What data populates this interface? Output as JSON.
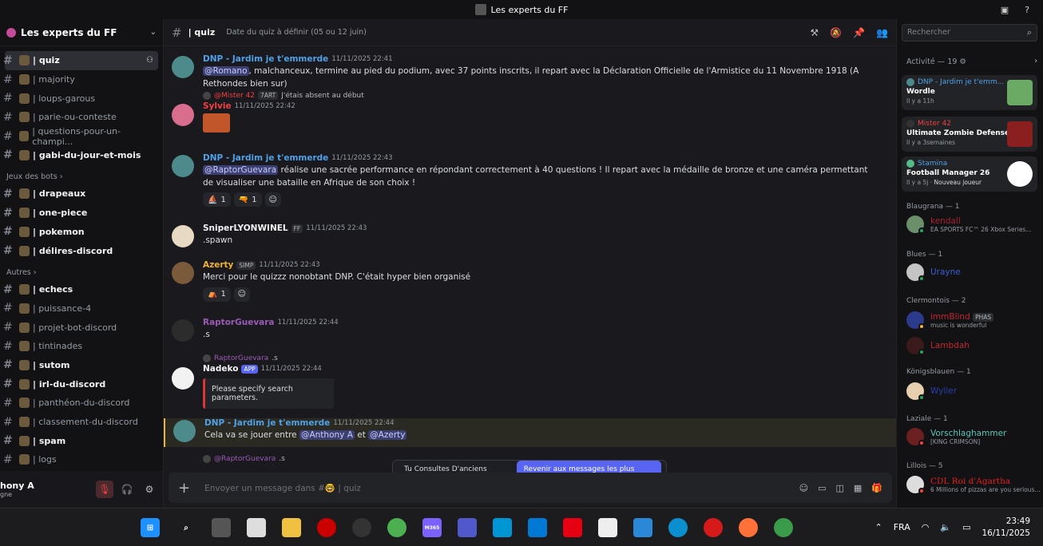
{
  "window": {
    "title": "Les experts du FF"
  },
  "server": {
    "name": "Les experts du FF"
  },
  "channels_top": [
    {
      "name": "| quiz",
      "active": true
    },
    {
      "name": "| majority"
    },
    {
      "name": "| loups-garous"
    },
    {
      "name": "| parie-ou-conteste"
    },
    {
      "name": "| questions-pour-un-champi..."
    },
    {
      "name": "| gabi-du-jour-et-mois",
      "bold": true
    }
  ],
  "category_bots": "Jeux des bots",
  "channels_bots": [
    {
      "name": "| drapeaux",
      "bold": true
    },
    {
      "name": "| one-piece",
      "bold": true
    },
    {
      "name": "| pokemon",
      "bold": true
    },
    {
      "name": "| délires-discord",
      "bold": true
    }
  ],
  "category_autres": "Autres",
  "channels_autres": [
    {
      "name": "| echecs",
      "bold": true
    },
    {
      "name": "| puissance-4"
    },
    {
      "name": "| projet-bot-discord"
    },
    {
      "name": "| tintinades"
    },
    {
      "name": "| sutom",
      "bold": true
    },
    {
      "name": "| irl-du-discord",
      "bold": true
    },
    {
      "name": "| panthéon-du-discord"
    },
    {
      "name": "| classement-du-discord"
    },
    {
      "name": "| spam",
      "bold": true
    },
    {
      "name": "| logs"
    }
  ],
  "user": {
    "name": "hony A",
    "status": "gne"
  },
  "header": {
    "channel": "| quiz",
    "topic": "Date du quiz à définir (05 ou 12 juin)"
  },
  "messages": {
    "m1": {
      "author": "DNP - Jardim je t'emmerde",
      "time": "11/11/2025 22:41",
      "mention": "@Romano",
      "text": ", malchanceux, termine au pied du podium, avec 37 points inscrits, il repart avec la Déclaration Officielle de l'Armistice du 11 Novembre 1918 (A Rethondes bien sur)"
    },
    "m2": {
      "reply_author": "@Mister 42",
      "reply_badge": "7ART",
      "reply_text": "J'étais absent au début",
      "author": "Sylvie",
      "time": "11/11/2025 22:42"
    },
    "m3": {
      "author": "DNP - Jardim je t'emmerde",
      "time": "11/11/2025 22:43",
      "mention": "@RaptorGuevara",
      "text": " réalise une sacrée performance en répondant correctement à 40 questions ! Il repart avec la médaille de bronze et une caméra permettant de visualiser une bataille en Afrique de son choix !",
      "r1": "1",
      "r2": "1"
    },
    "m4": {
      "author": "SniperLYONWINEL",
      "badge": "FF",
      "time": "11/11/2025 22:43",
      "text": ".spawn"
    },
    "m5": {
      "author": "Azerty",
      "badge": "SIMP",
      "time": "11/11/2025 22:43",
      "text": "Merci pour le quizzz nonobtant DNP. C'était hyper bien organisé",
      "r1": "1"
    },
    "m6": {
      "author": "RaptorGuevara",
      "time": "11/11/2025 22:44",
      "text": ".s"
    },
    "m7": {
      "reply_author": "RaptorGuevara",
      "reply_text": ".s",
      "author": "Nadeko",
      "badge": "APP",
      "time": "11/11/2025 22:44",
      "embed": "Please specify search parameters."
    },
    "m8": {
      "author": "DNP - Jardim je t'emmerde",
      "time": "11/11/2025 22:44",
      "text1": "Cela va se jouer entre ",
      "mention1": "@Anthony A",
      "text2": " et ",
      "mention2": "@Azerty"
    },
    "m9": {
      "reply_author": "@RaptorGuevara",
      "reply_text": ".s"
    }
  },
  "toast": {
    "text": "Tu Consultes D'anciens Messages",
    "button": "Revenir aux messages les plus récents"
  },
  "composer": {
    "placeholder": "Envoyer un message dans #🤓 | quiz"
  },
  "search": {
    "placeholder": "Rechercher"
  },
  "activity": {
    "title": "Activité — 19",
    "cards": [
      {
        "who": "DNP - Jardim je t'emm...",
        "game": "Wordle",
        "ago": "Il y a 11h"
      },
      {
        "who": "Mister 42",
        "game": "Ultimate Zombie Defense",
        "ago": "Il y a 3semaines"
      },
      {
        "who": "Stamina",
        "game": "Football Manager 26",
        "ago": "Il y a 5j",
        "extra": "Nouveau joueur"
      }
    ]
  },
  "members": {
    "blaugrana": "Blaugrana — 1",
    "kendall": "kendall",
    "kendall_sub": "EA SPORTS FC™ 26 Xbox Series...",
    "blues": "Blues — 1",
    "urayne": "Urayne",
    "clermontois": "Clermontois — 2",
    "immblind": "immBlind",
    "immblind_badge": "PHAS",
    "immblind_sub": "music is wonderful",
    "lambdah": "Lambdah",
    "konigsblauen": "Königsblauen — 1",
    "wyller": "Wyller",
    "laziale": "Laziale — 1",
    "vorschlag": "Vorschlaghammer",
    "vorschlag_sub": "[KING CRIMSON]",
    "lillois": "Lillois — 5",
    "cdl": "CDL Roi d'Agartha",
    "cdl_sub": "6 Millions of pizzas are you serious..."
  },
  "taskbar": {
    "lang": "FRA",
    "time": "23:49",
    "date": "16/11/2025",
    "m365": "M365"
  },
  "colors": {
    "accent": "#5865f2",
    "danger": "#f23f42",
    "mention_bg": "#3b3f72"
  }
}
